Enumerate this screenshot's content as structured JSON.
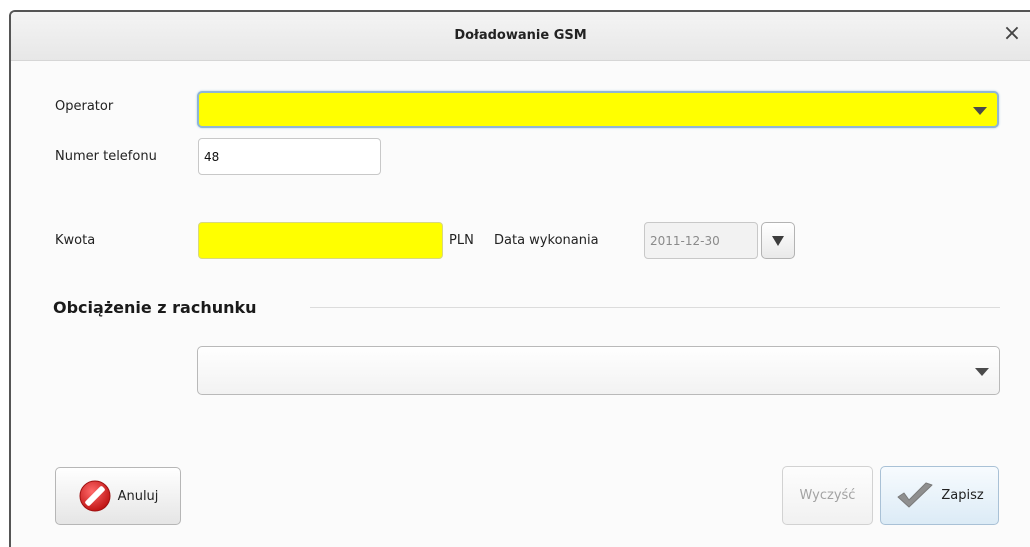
{
  "dialog": {
    "title": "Doładowanie GSM",
    "close_glyph": "×"
  },
  "form": {
    "operator_label": "Operator",
    "operator_value": "",
    "phone_label": "Numer telefonu",
    "phone_value": "48",
    "amount_label": "Kwota",
    "amount_value": "",
    "currency": "PLN",
    "date_label": "Data wykonania",
    "date_value": "2011-12-30"
  },
  "account_section": {
    "title": "Obciążenie z rachunku",
    "account_value": ""
  },
  "buttons": {
    "cancel_label": "Anuluj",
    "clear_label": "Wyczyść",
    "save_label": "Zapisz"
  },
  "icons": {
    "close": "close-icon",
    "dropdown": "chevron-down-icon",
    "cancel": "no-entry-icon",
    "save": "checkmark-icon"
  },
  "colors": {
    "required_field": "#ffff00",
    "focus_border": "#8fb6d6",
    "cancel_icon": "#d42020",
    "save_icon": "#8a8a8a"
  }
}
